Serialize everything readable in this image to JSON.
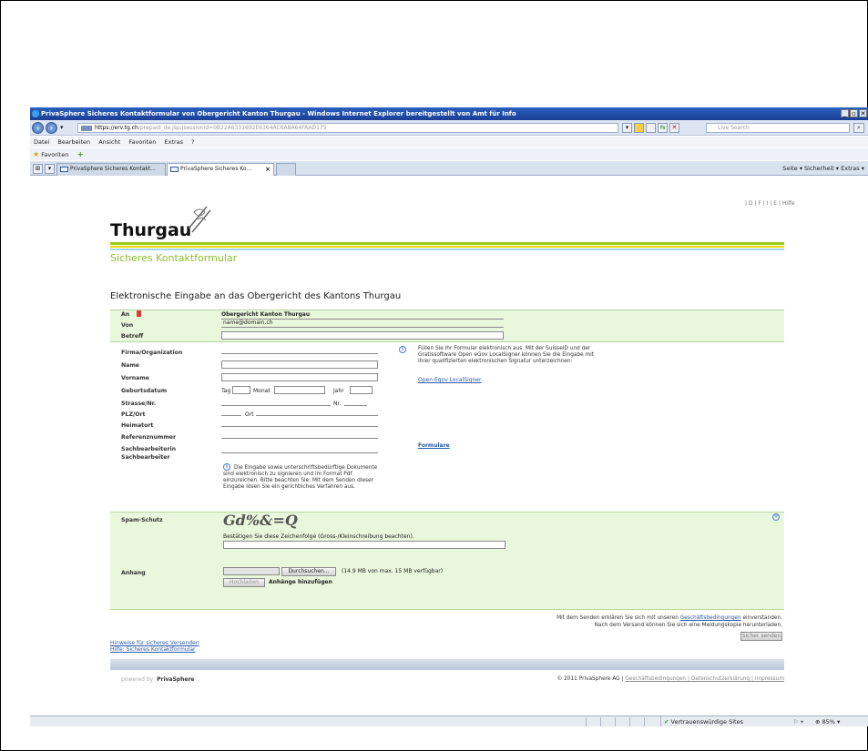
{
  "window": {
    "title": "PrivaSphere Sicheres Kontaktformular von Obergericht Kanton Thurgau - Windows Internet Explorer bereitgestellt von Amt für Info",
    "min": "_",
    "restore": "▫",
    "close": "✕"
  },
  "address": {
    "url_prefix": "https://",
    "url_host": "erv.tg.ch",
    "url_rest": "/prepaid_de.jsp;jsessionid=0B22A6331692E6164AC6A8A64FAAD175",
    "search_placeholder": "Live Search"
  },
  "menu": [
    "Datei",
    "Bearbeiten",
    "Ansicht",
    "Favoriten",
    "Extras",
    "?"
  ],
  "favorites": {
    "label": "Favoriten"
  },
  "tabs": [
    {
      "label": "PrivaSphere Sicheres Kontakt..."
    },
    {
      "label": "PrivaSphere Sicheres Ko..."
    }
  ],
  "commandbar": "Seite ▾   Sicherheit ▾   Extras ▾",
  "header": {
    "logo": "Thurgau",
    "toplinks": "| D | F | I | E | Hilfe",
    "subtitle": "Sicheres Kontaktformular"
  },
  "form": {
    "title": "Elektronische Eingabe an das Obergericht des Kantons Thurgau",
    "an_label": "An",
    "an_value": "Obergericht Kanton Thurgau",
    "von_label": "Von",
    "von_value": "name@domain.ch",
    "betreff_label": "Betreff",
    "fields": [
      "Firma/Organization",
      "Name",
      "Vorname",
      "Geburtsdatum",
      "Strasse/Nr.",
      "PLZ/Ort",
      "Heimatort",
      "Referenznummer",
      "Sachbearbeiterin",
      "Sachbearbeiter"
    ],
    "tag_label": "Tag",
    "monat_label": "Monat",
    "jahr_label": "Jahr",
    "nr_label": "Nr.",
    "ort_label": "Ort",
    "info_text": "Füllen Sie ihr Formular elektronisch aus. Mit der SuisseID und der Gratissoftware Open eGov LocalSigner können Sie die Eingabe mit Ihrer qualifizierten elektronischen Signatur unterzeichnen:",
    "info_link": "Open Egov LocalSigner",
    "formulare_link": "Formulare",
    "hint_text": "Die Eingabe sowie unterschriftsbedürftige Dokumente sind elektronisch zu signieren und im Format Pdf einzureichen. Bitte beachten Sie: Mit dem Senden dieser Eingabe lösen Sie ein gerichtliches Verfahren aus."
  },
  "spam": {
    "label": "Spam-Schutz",
    "captcha": "Gd%&=Q",
    "instruction": "Bestätigen Sie diese Zeichenfolge (Gross-/Kleinschreibung beachten)."
  },
  "attachment": {
    "label": "Anhang",
    "browse": "Durchsuchen...",
    "limit": "(14.9 MB von max. 15 MB verfügbar)",
    "upload": "Hochladen",
    "add": "Anhänge hinzufügen"
  },
  "legal": {
    "line1_pre": "Mit dem Senden erklären Sie sich mit unseren",
    "line1_link": "Geschäftsbedingungen",
    "line1_post": "einverstanden.",
    "line2": "Nach dem Versand können Sie sich eine Meldungskopie herunterladen.",
    "send": "Sicher senden"
  },
  "help_links": [
    "Hinweise für sicheres Versenden",
    "Hilfe: Sicheres Kontaktformular"
  ],
  "footer": {
    "powered": "powered by",
    "brand": "PrivaSphere",
    "copyright": "© 2011 PrivaSphere AG |",
    "links": "Geschäftsbedingungen | Datenschutzerklärung | Impressum"
  },
  "status": {
    "zone": "Vertrauenswürdige Sites",
    "zoom": "85%"
  }
}
